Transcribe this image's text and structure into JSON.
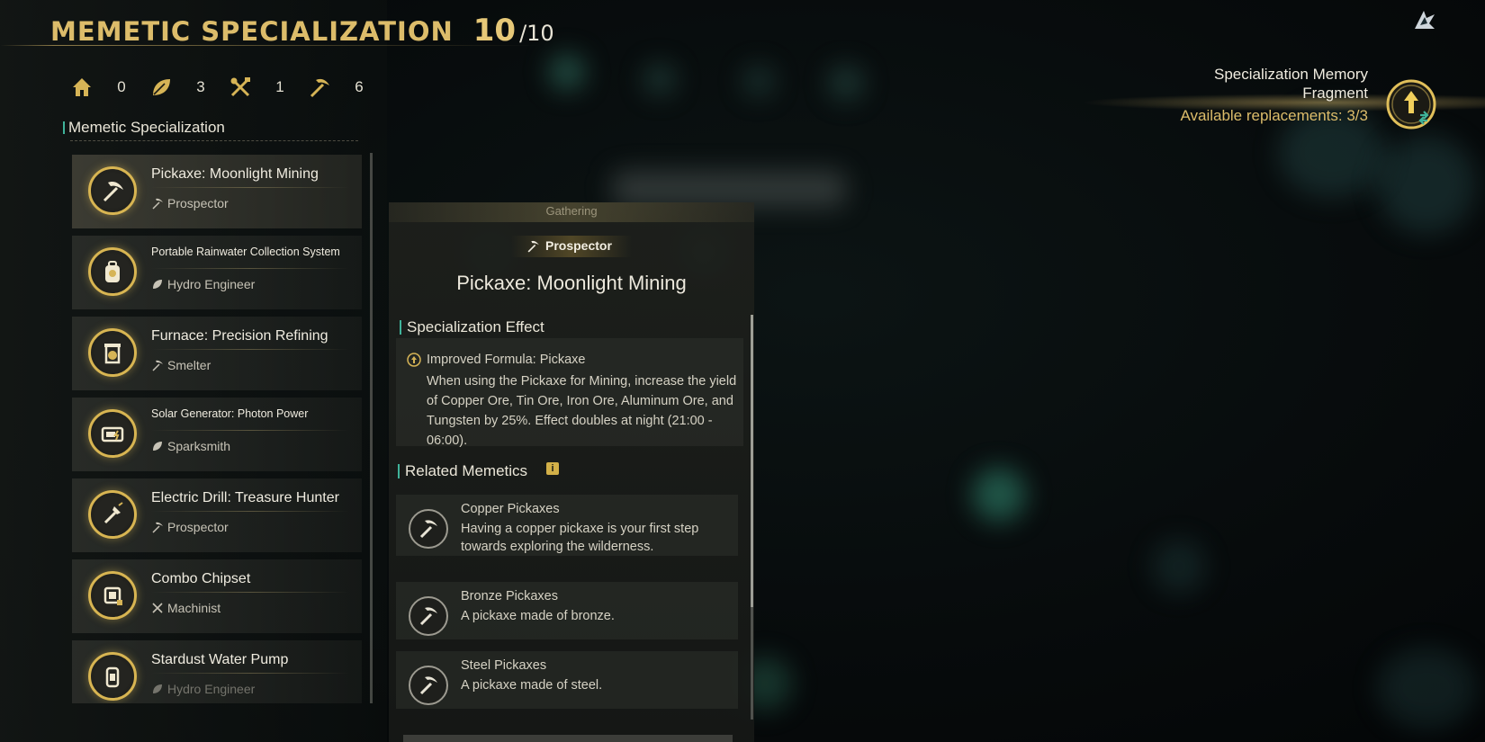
{
  "header": {
    "title": "MEMETIC SPECIALIZATION",
    "count": "10",
    "max": "/10"
  },
  "stats": [
    {
      "icon": "home-icon",
      "value": "0"
    },
    {
      "icon": "leaf-icon",
      "value": "3"
    },
    {
      "icon": "tools-icon",
      "value": "1"
    },
    {
      "icon": "pickaxe-icon",
      "value": "6"
    }
  ],
  "list": {
    "title": "Memetic Specialization",
    "items": [
      {
        "name": "Pickaxe: Moonlight Mining",
        "role": "Prospector",
        "role_icon": "pickaxe-icon",
        "icon": "pickaxe-icon",
        "selected": true
      },
      {
        "name": "Portable Rainwater Collection System",
        "role": "Hydro Engineer",
        "role_icon": "leaf-icon",
        "icon": "backpack-icon"
      },
      {
        "name": "Furnace: Precision Refining",
        "role": "Smelter",
        "role_icon": "pickaxe-icon",
        "icon": "furnace-icon"
      },
      {
        "name": "Solar Generator: Photon Power",
        "role": "Sparksmith",
        "role_icon": "leaf-icon",
        "icon": "generator-icon"
      },
      {
        "name": "Electric Drill: Treasure Hunter",
        "role": "Prospector",
        "role_icon": "pickaxe-icon",
        "icon": "drill-icon"
      },
      {
        "name": "Combo Chipset",
        "role": "Machinist",
        "role_icon": "tools-icon",
        "icon": "chip-icon"
      },
      {
        "name": "Stardust Water Pump",
        "role": "Hydro Engineer",
        "role_icon": "leaf-icon",
        "icon": "pump-icon"
      }
    ]
  },
  "detail": {
    "category": "Gathering",
    "spec": "Prospector",
    "title": "Pickaxe: Moonlight Mining",
    "effect_heading": "Specialization Effect",
    "effect_name": "Improved Formula: Pickaxe",
    "effect_text": "When using the Pickaxe for Mining, increase the yield of Copper Ore, Tin Ore, Iron Ore, Aluminum Ore, and Tungsten by 25%. Effect doubles at night (21:00 - 06:00).",
    "related_heading": "Related Memetics",
    "related": [
      {
        "name": "Copper Pickaxes",
        "desc": "Having a copper pickaxe is your first step towards exploring the wilderness."
      },
      {
        "name": "Bronze Pickaxes",
        "desc": "A pickaxe made of bronze."
      },
      {
        "name": "Steel Pickaxes",
        "desc": "A pickaxe made of steel."
      }
    ]
  },
  "fragment": {
    "title_line1": "Specialization Memory",
    "title_line2": "Fragment",
    "replacements": "Available replacements: 3/3"
  },
  "colors": {
    "gold": "#dcbc6a",
    "teal_accent": "#3fb39a",
    "text": "#e8e4d6"
  }
}
